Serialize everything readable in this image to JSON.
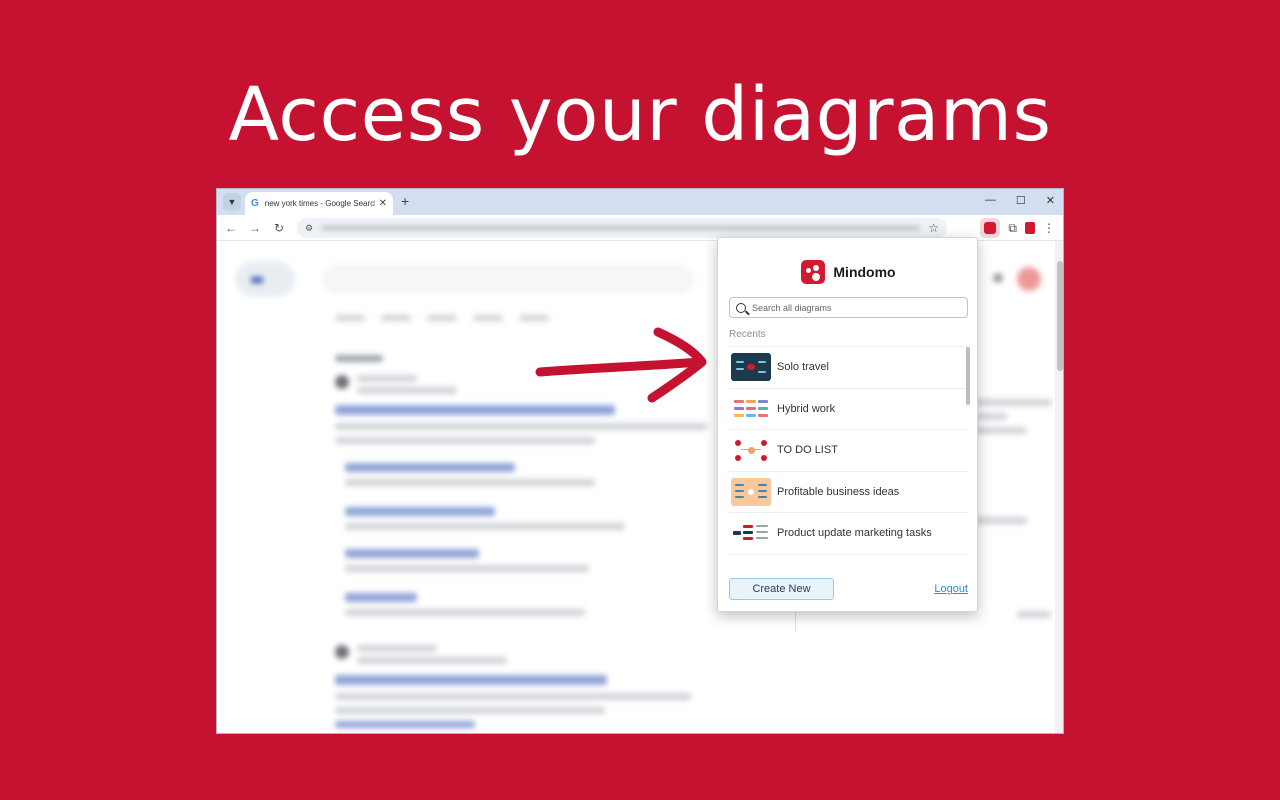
{
  "headline": "Access your diagrams",
  "browser": {
    "tab_title": "new york times - Google Search",
    "tab_close": "✕",
    "new_tab": "+",
    "minimize": "—",
    "maximize": "☐",
    "close": "✕",
    "back": "←",
    "forward": "→",
    "reload": "↻",
    "star": "☆"
  },
  "popup": {
    "brand_name": "Mindomo",
    "search_placeholder": "Search all diagrams",
    "recents_label": "Recents",
    "recents": [
      {
        "label": "Solo travel",
        "thumb": "dark"
      },
      {
        "label": "Hybrid work",
        "thumb": "light"
      },
      {
        "label": "TO DO LIST",
        "thumb": "light"
      },
      {
        "label": "Profitable business ideas",
        "thumb": "peach"
      },
      {
        "label": "Product update marketing tasks",
        "thumb": "light"
      }
    ],
    "create_new": "Create New",
    "logout": "Logout"
  },
  "colors": {
    "background": "#c41230",
    "brand_red": "#d4182f",
    "link_blue": "#2a8bd8"
  }
}
